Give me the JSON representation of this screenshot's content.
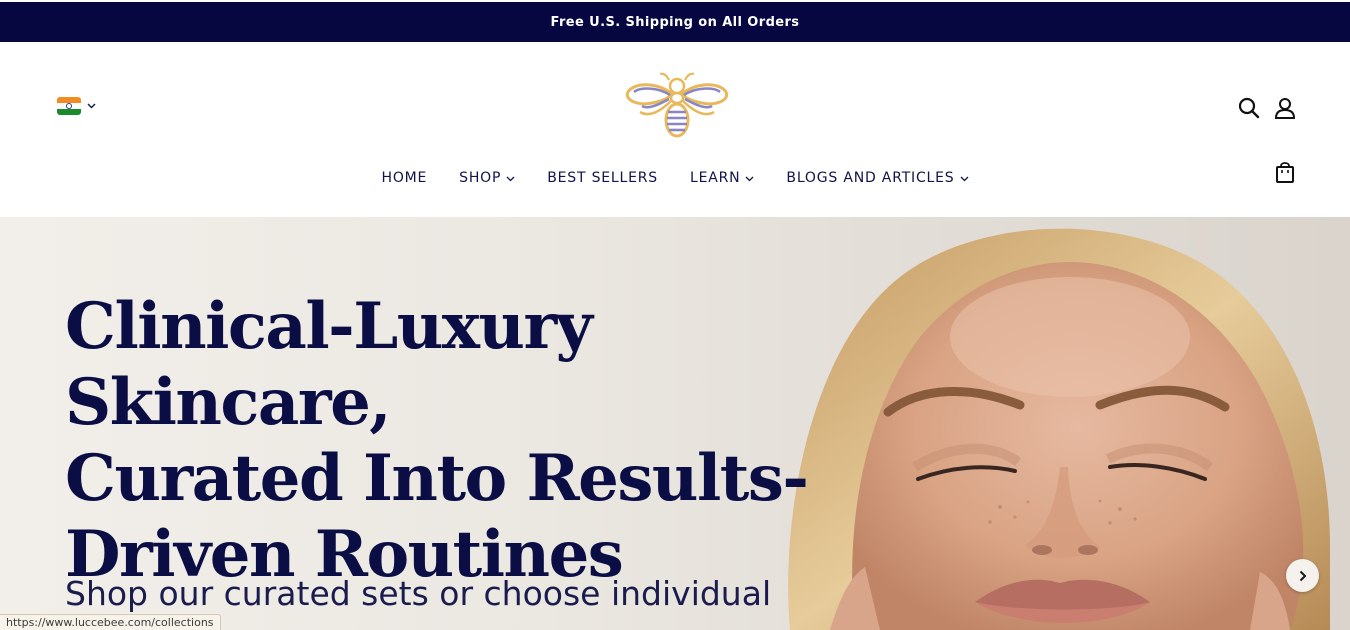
{
  "announcement": {
    "text": "Free U.S. Shipping on All Orders"
  },
  "header": {
    "country": {
      "flag": "india-flag-icon",
      "dropdown_icon": "chevron-down-icon"
    },
    "logo": {
      "icon": "bee-logo-icon"
    },
    "icons": [
      "search-icon",
      "account-icon",
      "shopping-bag-icon"
    ]
  },
  "nav": {
    "home": "HOME",
    "shop": "SHOP",
    "best_sellers": "BEST SELLERS",
    "learn": "LEARN",
    "blogs": "BLOGS AND ARTICLES"
  },
  "hero": {
    "headline_line1": "Clinical-Luxury Skincare,",
    "headline_line2": "Curated Into Results-",
    "headline_line3": "Driven Routines",
    "subtext": "Shop our curated sets or choose individual",
    "next_icon": "chevron-right-icon"
  },
  "status_bar": {
    "url": "https://www.luccebee.com/collections"
  },
  "colors": {
    "navy": "#060640",
    "gold": "#e8b95a",
    "lavender": "#8a86c4"
  }
}
